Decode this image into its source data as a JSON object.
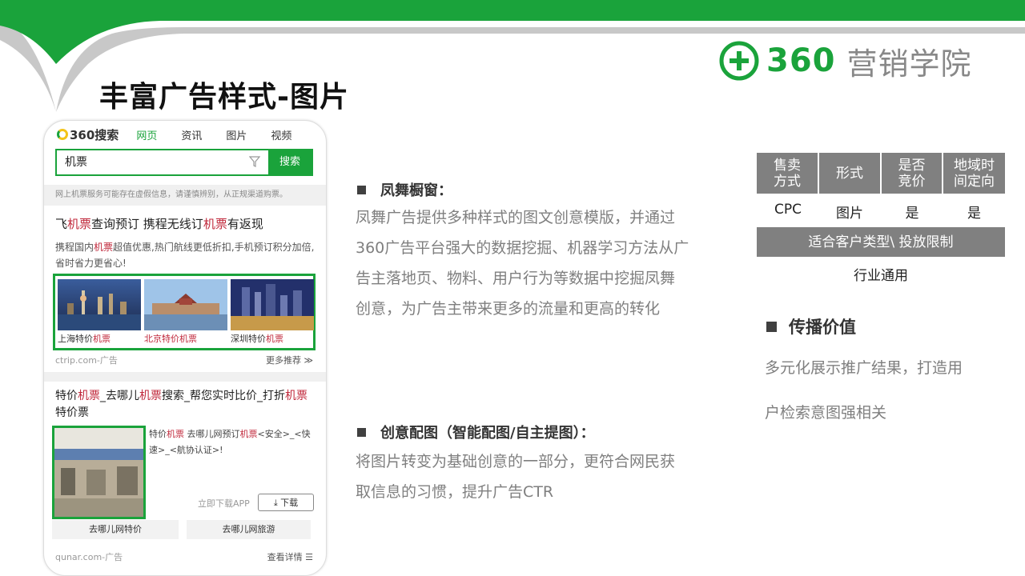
{
  "colors": {
    "brand_green": "#1aa33b",
    "gray_header": "#808080",
    "body_gray": "#7f7f7f",
    "highlight_red": "#c0283b"
  },
  "brand": {
    "logo_text": "360",
    "name": "营销学院",
    "icon": "plus-circle-icon"
  },
  "page_title": "丰富广告样式-图片",
  "phone": {
    "logo": "360搜索",
    "tabs": [
      "网页",
      "资讯",
      "图片",
      "视频"
    ],
    "search_value": "机票",
    "search_button": "搜索",
    "notice": "网上机票服务可能存在虚假信息，请谨慎辨别，从正规渠道购票。",
    "ad1": {
      "title_parts": [
        "飞",
        "机票",
        "查询预订 携程无线订",
        "机票",
        "有返现"
      ],
      "desc_parts": [
        "携程国内",
        "机票",
        "超值优惠,热门航线更低折扣,手机预订积分加倍,省时省力更省心!"
      ],
      "thumbs": [
        {
          "city": "上海特价",
          "kw": "机票"
        },
        {
          "city": "北京特价",
          "kw": "机票"
        },
        {
          "city": "深圳特价",
          "kw": "机票"
        }
      ],
      "source": "ctrip.com-广告",
      "more": "更多推荐 ≫"
    },
    "ad2": {
      "title_parts": [
        "特价",
        "机票",
        "_去哪儿",
        "机票",
        "搜索_帮您实时比价_打折",
        "机票",
        "特价票"
      ],
      "desc_parts": [
        "特价",
        "机票",
        " 去哪儿网预订",
        "机票",
        "<安全>_<快速>_<航协认证>!"
      ],
      "app_text": "立即下载APP",
      "download": "下载",
      "buttons": [
        "去哪儿网特价",
        "去哪儿网旅游"
      ],
      "source": "qunar.com-广告",
      "detail": "查看详情 ☰"
    }
  },
  "section1": {
    "heading": "凤舞橱窗：",
    "lines": [
      "凤舞广告提供多种样式的图文创意模版，并通过",
      "360广告平台强大的数据挖掘、机器学习方法从广",
      "告主落地页、物料、用户行为等数据中挖掘凤舞",
      "创意，为广告主带来更多的流量和更高的转化"
    ]
  },
  "section2": {
    "heading": "创意配图（智能配图/自主提图）：",
    "lines": [
      "将图片转变为基础创意的一部分，更符合网民获",
      "取信息的习惯，提升广告CTR"
    ]
  },
  "table": {
    "headers": [
      [
        "售卖",
        "方式"
      ],
      [
        "形式"
      ],
      [
        "是否",
        "竞价"
      ],
      [
        "地域时",
        "间定向"
      ]
    ],
    "values": [
      "CPC",
      "图片",
      "是",
      "是"
    ],
    "sub_header": "适合客户类型\\ 投放限制",
    "sub_value": "行业通用"
  },
  "right": {
    "heading": "传播价值",
    "lines": [
      "多元化展示推广结果，打造用",
      "户检索意图强相关"
    ]
  }
}
